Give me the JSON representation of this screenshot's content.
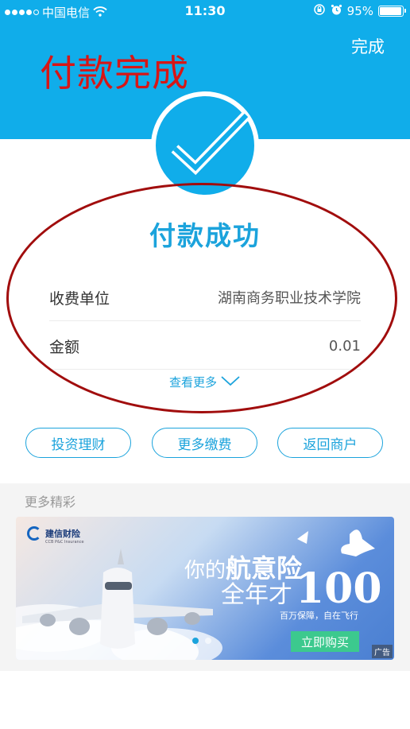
{
  "status_bar": {
    "carrier": "中国电信",
    "time": "11:30",
    "battery": "95%",
    "battery_level": 0.95,
    "signal_bars": 4
  },
  "header": {
    "done_label": "完成",
    "overlay_title": "付款完成"
  },
  "result": {
    "title": "付款成功",
    "rows": [
      {
        "label": "收费单位",
        "value": "湖南商务职业技术学院"
      },
      {
        "label": "金额",
        "value": "0.01"
      }
    ],
    "more_link": "查看更多"
  },
  "actions": [
    {
      "label": "投资理财"
    },
    {
      "label": "更多缴费"
    },
    {
      "label": "返回商户"
    }
  ],
  "more_section": {
    "title": "更多精彩",
    "banner": {
      "brand": "建信财险",
      "brand_sub": "CCB P&C Insurance",
      "line1_a": "你的",
      "line1_b": "航意险",
      "line2_a": "全年才",
      "line2_b": "100",
      "subtitle": "百万保障，自在飞行",
      "buy_label": "立即购买",
      "ad_label": "广告",
      "page_count": 2,
      "active_page": 1
    }
  },
  "colors": {
    "primary": "#10adea",
    "accent_text": "#1ba3dc",
    "annotation_red": "#d71616",
    "buy_green": "#3cc98e"
  }
}
